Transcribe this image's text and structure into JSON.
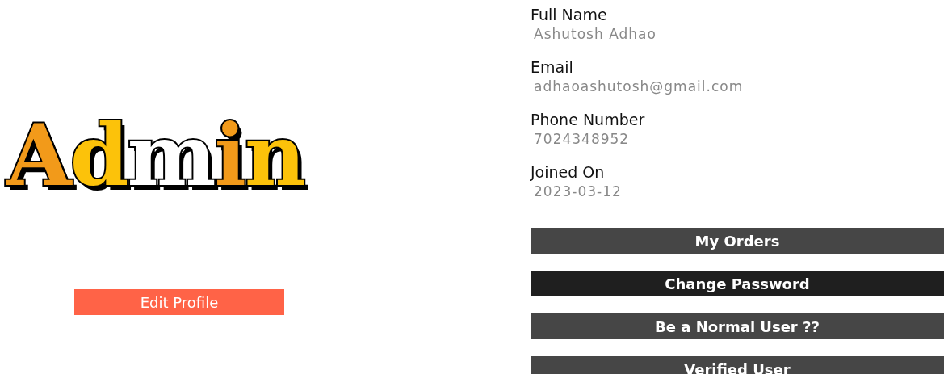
{
  "logo": {
    "text": "Admin"
  },
  "edit_button": {
    "label": "Edit Profile"
  },
  "fields": [
    {
      "label": "Full Name",
      "value": "Ashutosh Adhao"
    },
    {
      "label": "Email",
      "value": "adhaoashutosh@gmail.com"
    },
    {
      "label": "Phone Number",
      "value": "7024348952"
    },
    {
      "label": "Joined On",
      "value": "2023-03-12"
    }
  ],
  "buttons": [
    {
      "label": "My Orders",
      "hovered": false
    },
    {
      "label": "Change Password",
      "hovered": true
    },
    {
      "label": "Be a Normal User ??",
      "hovered": false
    },
    {
      "label": "Verified User",
      "hovered": false
    }
  ]
}
